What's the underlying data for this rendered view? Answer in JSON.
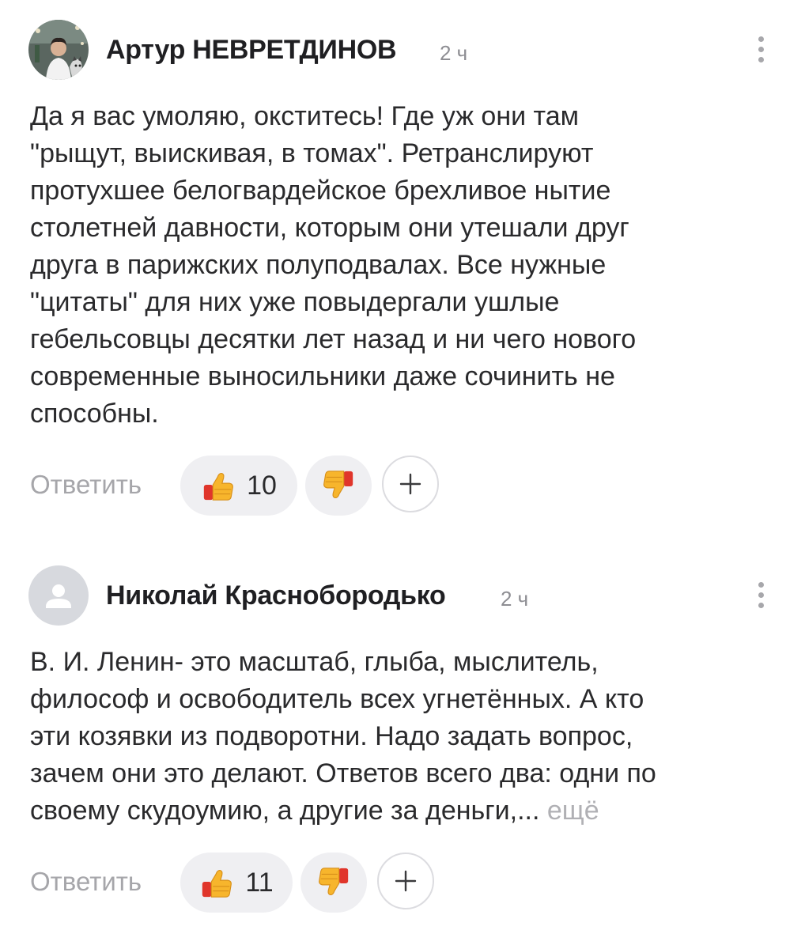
{
  "comments": [
    {
      "author": "Артур НЕВРЕТДИНОВ",
      "time": "2 ч",
      "avatar": "photo-avatar",
      "text": "Да я вас умоляю, окститесь! Где уж они там\n\"рыщут, выискивая, в томах\". Ретранслируют\nпротухшее белогвардейское брехливое нытие\nстолетней давности, которым они утешали друг\nдруга в парижских полуподвалах. Все нужные\n\"цитаты\" для них уже повыдергали ушлые\nгебельсовцы десятки лет назад и ни чего нового\nсовременные выносильники даже сочинить не\nспособны.",
      "more": "",
      "reply_label": "Ответить",
      "likes": "10",
      "like_icon": "thumbs-up-icon",
      "dislike_icon": "thumbs-down-icon",
      "add_icon": "plus-icon"
    },
    {
      "author": "Николай Краснобородько",
      "time": "2 ч",
      "avatar": "default-user-avatar",
      "text": "В. И. Ленин- это масштаб, глыба, мыслитель,\nфилософ и освободитель всех угнетённых. А кто\nэти козявки из подворотни. Надо задать вопрос,\nзачем они это делают. Ответов всего два: одни по\nсвоему скудоумию, а другие за деньги,...",
      "more": "ещё",
      "reply_label": "Ответить",
      "likes": "11",
      "like_icon": "thumbs-up-icon",
      "dislike_icon": "thumbs-down-icon",
      "add_icon": "plus-icon"
    }
  ],
  "colors": {
    "pill_bg": "#efeff2",
    "muted_text": "#a6a6aa",
    "emoji_yellow": "#f7b52c",
    "emoji_red": "#e0352b"
  }
}
